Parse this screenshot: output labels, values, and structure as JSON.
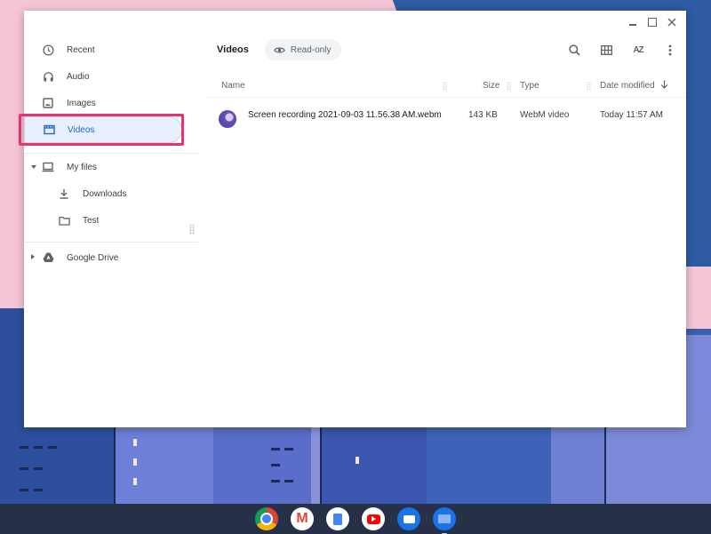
{
  "window": {
    "controls": {
      "minimize": "minimize",
      "maximize": "maximize",
      "close": "close"
    }
  },
  "sidebar": {
    "items": [
      {
        "label": "Recent",
        "icon": "clock-icon"
      },
      {
        "label": "Audio",
        "icon": "headphones-icon"
      },
      {
        "label": "Images",
        "icon": "image-icon"
      },
      {
        "label": "Videos",
        "icon": "video-icon",
        "selected": true
      },
      {
        "label": "My files",
        "icon": "laptop-icon",
        "expanded": true
      },
      {
        "label": "Downloads",
        "icon": "download-icon"
      },
      {
        "label": "Test",
        "icon": "folder-icon"
      },
      {
        "label": "Google Drive",
        "icon": "drive-icon",
        "expanded": false
      }
    ],
    "highlight_color": "#e8336e"
  },
  "toolbar": {
    "title": "Videos",
    "badge": "Read-only",
    "icons": [
      "search-icon",
      "grid-view-icon",
      "sort-az-icon",
      "more-vert-icon"
    ]
  },
  "table": {
    "columns": [
      "Name",
      "Size",
      "Type",
      "Date modified"
    ],
    "sort": {
      "column": "Date modified",
      "direction": "descending"
    },
    "rows": [
      {
        "name": "Screen recording 2021-09-03 11.56.38 AM.webm",
        "size": "143 KB",
        "type": "WebM video",
        "modified": "Today 11:57 AM"
      }
    ]
  },
  "shelf": {
    "apps": [
      "Chrome",
      "Gmail",
      "Docs",
      "YouTube",
      "Messages",
      "Files"
    ]
  },
  "colors": {
    "accent": "#1967d2",
    "selected_bg": "#e8f0fe",
    "shelf": "#263046"
  }
}
